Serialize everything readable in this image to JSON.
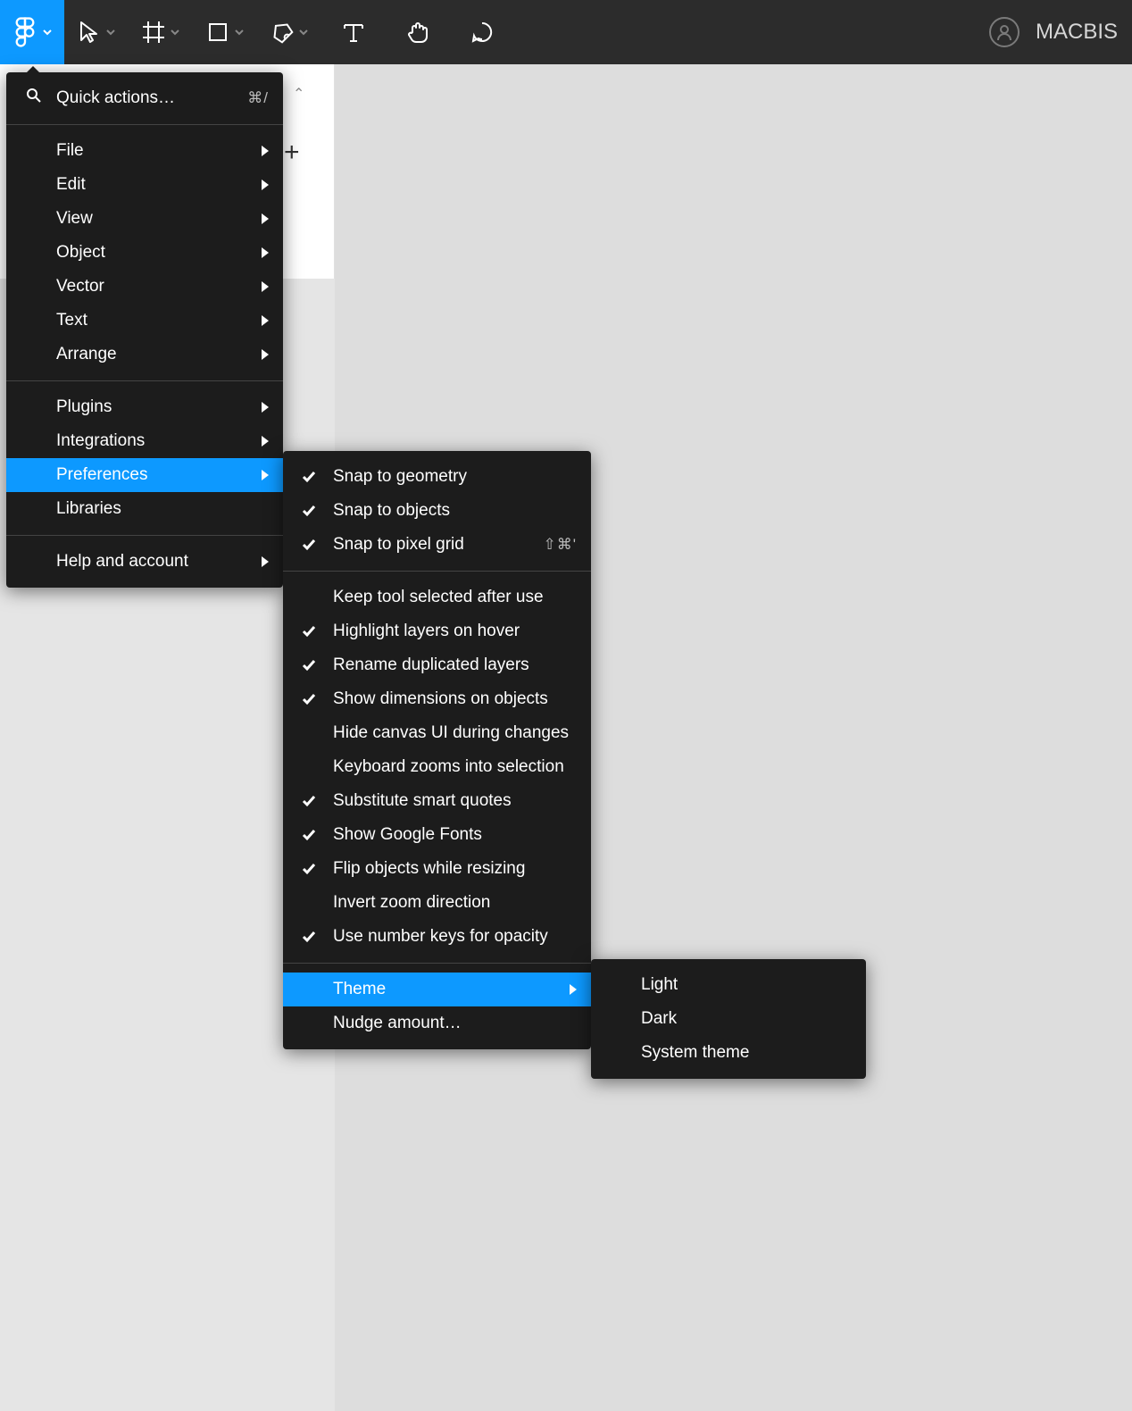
{
  "toolbar": {
    "teamName": "MACBIS"
  },
  "mainMenu": {
    "quickActions": {
      "label": "Quick actions…",
      "shortcut": "⌘/"
    },
    "group1": [
      {
        "label": "File",
        "hasSubmenu": true
      },
      {
        "label": "Edit",
        "hasSubmenu": true
      },
      {
        "label": "View",
        "hasSubmenu": true
      },
      {
        "label": "Object",
        "hasSubmenu": true
      },
      {
        "label": "Vector",
        "hasSubmenu": true
      },
      {
        "label": "Text",
        "hasSubmenu": true
      },
      {
        "label": "Arrange",
        "hasSubmenu": true
      }
    ],
    "group2": [
      {
        "label": "Plugins",
        "hasSubmenu": true
      },
      {
        "label": "Integrations",
        "hasSubmenu": true
      },
      {
        "label": "Preferences",
        "hasSubmenu": true,
        "highlighted": true
      },
      {
        "label": "Libraries",
        "hasSubmenu": false
      }
    ],
    "group3": [
      {
        "label": "Help and account",
        "hasSubmenu": true
      }
    ]
  },
  "preferencesMenu": {
    "group1": [
      {
        "label": "Snap to geometry",
        "checked": true
      },
      {
        "label": "Snap to objects",
        "checked": true
      },
      {
        "label": "Snap to pixel grid",
        "checked": true,
        "shortcut": "⇧⌘'"
      }
    ],
    "group2": [
      {
        "label": "Keep tool selected after use",
        "checked": false
      },
      {
        "label": "Highlight layers on hover",
        "checked": true
      },
      {
        "label": "Rename duplicated layers",
        "checked": true
      },
      {
        "label": "Show dimensions on objects",
        "checked": true
      },
      {
        "label": "Hide canvas UI during changes",
        "checked": false
      },
      {
        "label": "Keyboard zooms into selection",
        "checked": false
      },
      {
        "label": "Substitute smart quotes",
        "checked": true
      },
      {
        "label": "Show Google Fonts",
        "checked": true
      },
      {
        "label": "Flip objects while resizing",
        "checked": true
      },
      {
        "label": "Invert zoom direction",
        "checked": false
      },
      {
        "label": "Use number keys for opacity",
        "checked": true
      }
    ],
    "group3": [
      {
        "label": "Theme",
        "hasSubmenu": true,
        "highlighted": true
      },
      {
        "label": "Nudge amount…",
        "hasSubmenu": false
      }
    ]
  },
  "themeMenu": {
    "items": [
      {
        "label": "Light"
      },
      {
        "label": "Dark"
      },
      {
        "label": "System theme"
      }
    ]
  }
}
